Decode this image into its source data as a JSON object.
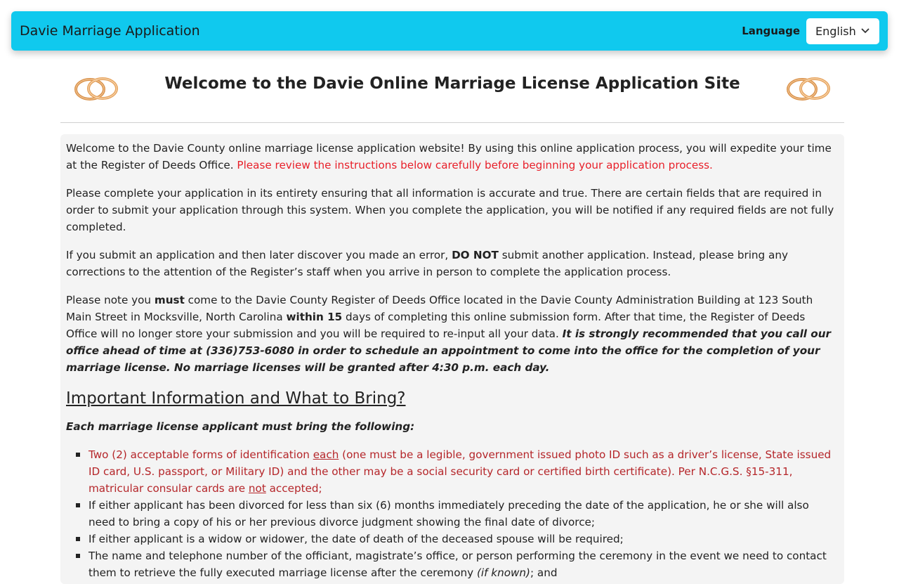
{
  "app": {
    "title": "Davie Marriage Application"
  },
  "language": {
    "label": "Language",
    "selected": "English"
  },
  "header": {
    "title": "Welcome to the Davie Online Marriage License Application Site"
  },
  "intro": {
    "p1_text": "Welcome to the Davie County online marriage license application website! By using this online application process, you will expedite your time at the Register of Deeds Office.",
    "p1_red": "Please review the instructions below carefully before beginning your application process.",
    "p2": "Please complete your application in its entirety ensuring that all information is accurate and true. There are certain fields that are required in order to submit your application through this system. When you complete the application, you will be notified if any required fields are not fully completed.",
    "p3_a": "If you submit an application and then later discover you made an error,",
    "p3_b": "DO NOT",
    "p3_c": "submit another application. Instead, please bring any corrections to the attention of the Register’s staff when you arrive in person to complete the application process.",
    "p4_a": "Please note you",
    "p4_b": "must",
    "p4_c": "come to the Davie County Register of Deeds Office located in the Davie County Administration Building at 123 South Main Street in Mocksville, North Carolina",
    "p4_d": "within 15",
    "p4_e": "days of completing this online submission form. After that time, the Register of Deeds Office will no longer store your submission and you will be required to re-input all your data.",
    "p4_f": "It is strongly recommended that you call our office ahead of time at (336)753-6080 in order to schedule an appointment to come into the office for the completion of your marriage license. No marriage licenses will be granted after 4:30 p.m. each day."
  },
  "important": {
    "heading": "Important Information and What to Bring?",
    "lead": "Each marriage license applicant must bring the following:",
    "item1_a": "Two (2) acceptable forms of identification",
    "item1_b": "each",
    "item1_c": "(one must be a legible, government issued photo ID such as a driver’s license, State issued ID card, U.S. passport, or Military ID) and the other may be a social security card or certified birth certificate). Per N.C.G.S. §15-311, matricular consular cards are",
    "item1_d": "not",
    "item1_e": "accepted;",
    "item2": "If either applicant has been divorced for less than six (6) months immediately preceding the date of the application, he or she will also need to bring a copy of his or her previous divorce judgment showing the final date of divorce;",
    "item3": "If either applicant is a widow or widower, the date of death of the deceased spouse will be required;",
    "item4_a": "The name and telephone number of the officiant, magistrate’s office, or person performing the ceremony in the event we need to contact them to retrieve the fully executed marriage license after the ceremony",
    "item4_b": "(if known)",
    "item4_c": "; and"
  },
  "colors": {
    "topbar": "#10c9ee",
    "notice_red": "#e8202a",
    "list_red": "#b5262a",
    "panel_bg": "#f4f4f4"
  },
  "icons": [
    "wedding-rings-icon",
    "chevron-down-icon"
  ]
}
